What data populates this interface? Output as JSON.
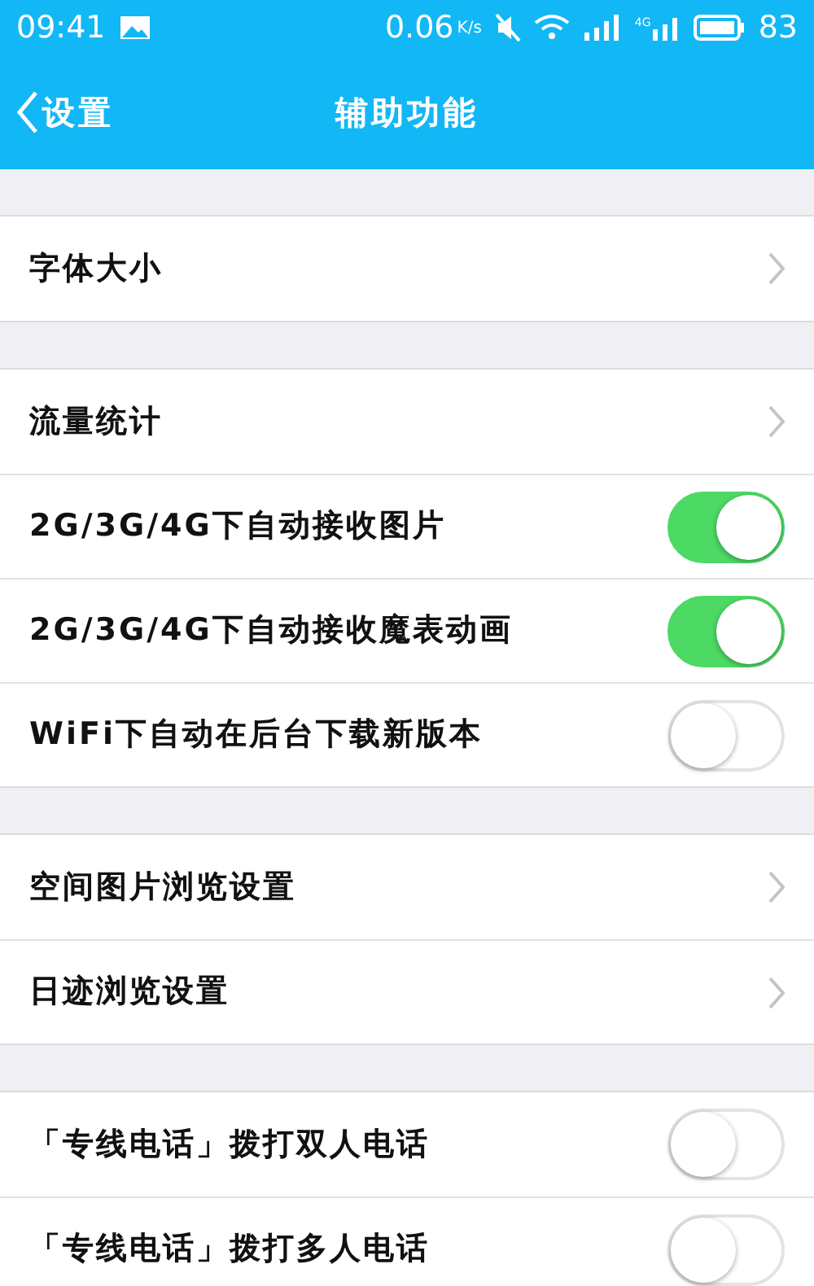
{
  "status_bar": {
    "time": "09:41",
    "speed": "0.06",
    "speed_unit": "K/s",
    "network": "4G",
    "battery": "83"
  },
  "nav": {
    "back": "设置",
    "title": "辅助功能"
  },
  "groups": [
    {
      "items": [
        {
          "kind": "chevron",
          "label": "字体大小"
        }
      ]
    },
    {
      "items": [
        {
          "kind": "chevron",
          "label": "流量统计"
        },
        {
          "kind": "toggle",
          "label": "2G/3G/4G下自动接收图片",
          "on": true
        },
        {
          "kind": "toggle",
          "label": "2G/3G/4G下自动接收魔表动画",
          "on": true
        },
        {
          "kind": "toggle",
          "label": "WiFi下自动在后台下载新版本",
          "on": false
        }
      ]
    },
    {
      "items": [
        {
          "kind": "chevron",
          "label": "空间图片浏览设置"
        },
        {
          "kind": "chevron",
          "label": "日迹浏览设置"
        }
      ]
    },
    {
      "items": [
        {
          "kind": "toggle",
          "label": "「专线电话」拨打双人电话",
          "on": false
        },
        {
          "kind": "toggle",
          "label": "「专线电话」拨打多人电话",
          "on": false
        }
      ]
    }
  ]
}
